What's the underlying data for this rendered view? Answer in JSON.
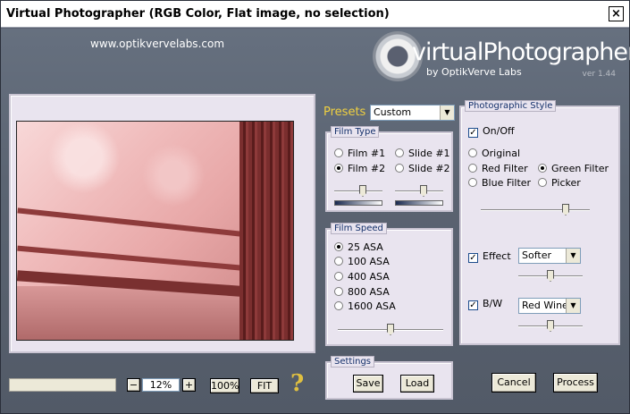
{
  "window": {
    "title": "Virtual Photographer (RGB Color, Flat image, no selection)",
    "close_label": "×"
  },
  "branding": {
    "website": "www.optikvervelabs.com",
    "logo_text": "virtualPhotographer",
    "logo_sub": "by OptikVerve Labs",
    "version": "ver 1.44"
  },
  "zoom": {
    "minus_label": "−",
    "value": "12%",
    "plus_label": "+",
    "hundred_label": "100%",
    "fit_label": "FIT",
    "help_label": "?"
  },
  "presets": {
    "label": "Presets",
    "selected": "Custom"
  },
  "film_type": {
    "title": "Film Type",
    "options": [
      "Film #1",
      "Slide #1",
      "Film #2",
      "Slide #2"
    ],
    "selected": "Film #2",
    "slider_left": 0.6,
    "slider_right": 0.6
  },
  "film_speed": {
    "title": "Film Speed",
    "options": [
      "25 ASA",
      "100 ASA",
      "400 ASA",
      "800 ASA",
      "1600 ASA"
    ],
    "selected": "25 ASA",
    "slider": 0.5
  },
  "settings": {
    "title": "Settings",
    "save_label": "Save",
    "load_label": "Load"
  },
  "photographic_style": {
    "title": "Photographic Style",
    "onoff_label": "On/Off",
    "onoff_checked": true,
    "options": [
      "Original",
      "Red Filter",
      "Green Filter",
      "Blue Filter",
      "Picker"
    ],
    "selected": "Green Filter",
    "filter_slider": 0.8,
    "effect_label": "Effect",
    "effect_checked": true,
    "effect_value": "Softer",
    "effect_slider": 0.5,
    "bw_label": "B/W",
    "bw_checked": true,
    "bw_value": "Red Wine",
    "bw_slider": 0.5
  },
  "actions": {
    "cancel_label": "Cancel",
    "process_label": "Process"
  },
  "colors": {
    "accent": "#f0d040",
    "panel_bg": "#e9e4ef",
    "window_bg": "#5a6070"
  }
}
